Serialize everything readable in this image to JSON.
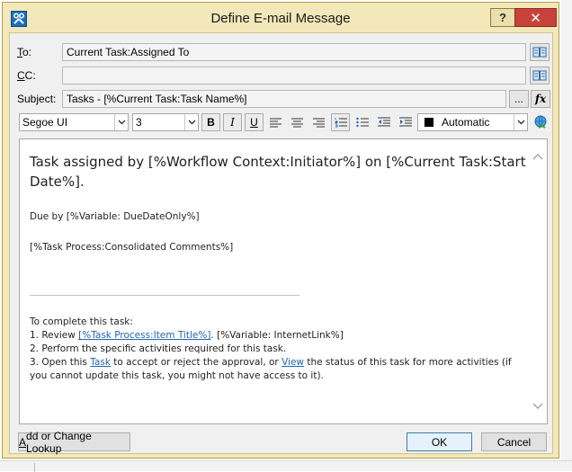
{
  "window": {
    "title": "Define E-mail Message",
    "help_label": "?",
    "close_label": "✕"
  },
  "fields": {
    "to_label_key": "T",
    "to_label_rest": "o:",
    "to_value": "Current Task:Assigned To",
    "cc_label_key": "C",
    "cc_label_rest": "C:",
    "cc_value": "",
    "subject_label": "Subject:",
    "subject_value": "Tasks - [%Current Task:Task Name%]",
    "ellipsis_label": "...",
    "fx_label": "fx"
  },
  "toolbar": {
    "font": "Segoe UI",
    "size": "3",
    "bold": "B",
    "italic": "I",
    "underline": "U",
    "color_label": "Automatic",
    "color_swatch": "#000000"
  },
  "body": {
    "heading": "Task assigned by [%Workflow Context:Initiator%] on [%Current Task:Start Date%].",
    "due": "Due by [%Variable: DueDateOnly%]",
    "comments": "[%Task Process:Consolidated Comments%]",
    "complete_intro": "To complete this task:",
    "step1_prefix": "1. Review ",
    "step1_link": "[%Task Process:Item Title%]",
    "step1_suffix": ". [%Variable: InternetLink%]",
    "step2": "2. Perform the specific activities required for this task.",
    "step3_prefix": "3. Open this ",
    "step3_link1": "Task",
    "step3_middle": " to accept or reject the approval, or ",
    "step3_link2": "View",
    "step3_suffix": " the status of this task for more activities (if you cannot update this task, you might not have access to it)."
  },
  "buttons": {
    "lookup_key": "A",
    "lookup_rest": "dd or Change Lookup",
    "ok": "OK",
    "cancel": "Cancel"
  },
  "colors": {
    "frame": "#f2e8ba",
    "close": "#c7433a",
    "link": "#1f66b0"
  }
}
